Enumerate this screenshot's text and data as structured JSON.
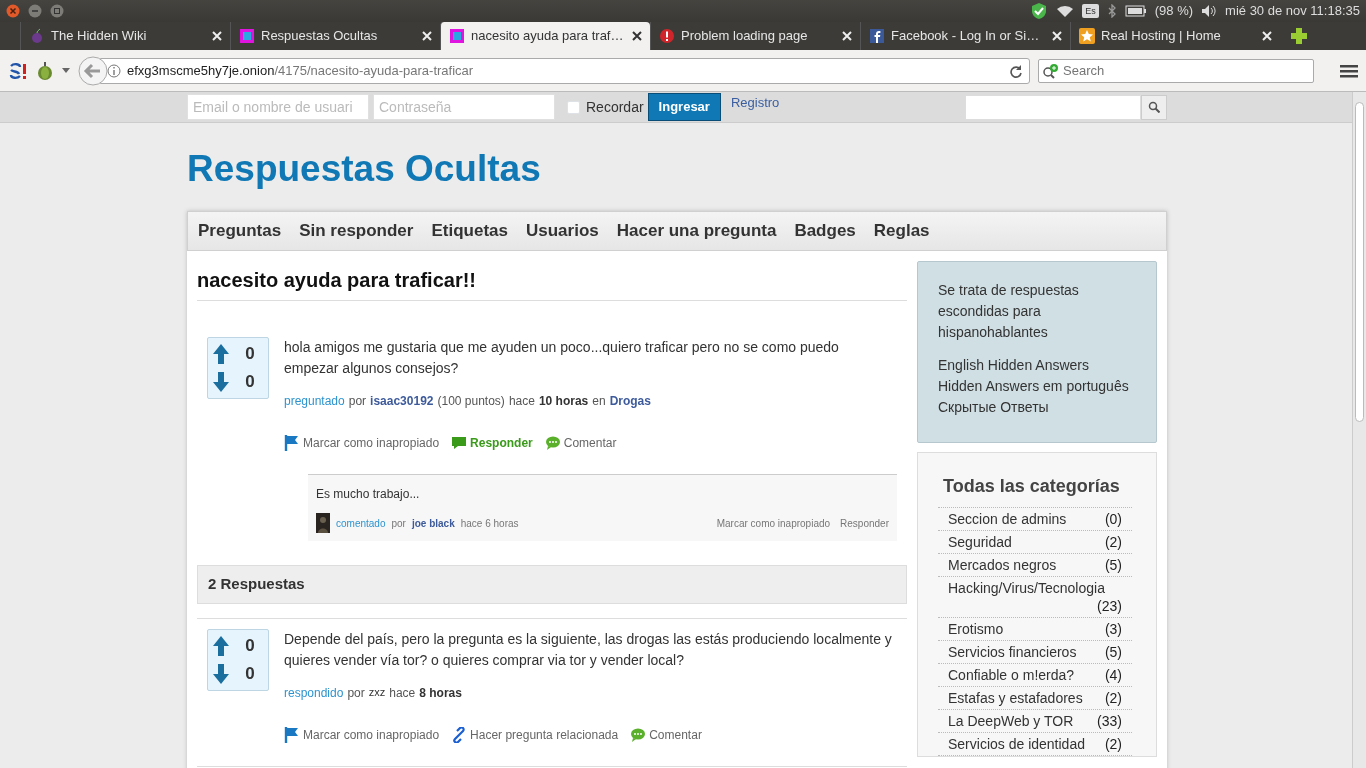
{
  "system_bar": {
    "keyboard": "Es",
    "battery": "(98 %)",
    "clock": "mié 30 de nov 11:18:35"
  },
  "tabs": [
    {
      "title": "The Hidden Wiki",
      "kind": "onion",
      "selected": false
    },
    {
      "title": "Respuestas Ocultas",
      "kind": "site",
      "selected": false
    },
    {
      "title": "nacesito ayuda para traf…",
      "kind": "site",
      "selected": true
    },
    {
      "title": "Problem loading page",
      "kind": "error",
      "selected": false
    },
    {
      "title": "Facebook - Log In or Si…",
      "kind": "facebook",
      "selected": false
    },
    {
      "title": "Real Hosting | Home",
      "kind": "star",
      "selected": false
    }
  ],
  "toolbar": {
    "url_host": "efxg3mscme5hy7je.onion",
    "url_path": "/4175/nacesito-ayuda-para-traficar",
    "search_placeholder": "Search"
  },
  "login": {
    "email_placeholder": "Email o nombre de usuari",
    "password_placeholder": "Contraseña",
    "remember_label": "Recordar",
    "remember_checked": false,
    "login_button": "Ingresar",
    "register_link": "Registro"
  },
  "site_title": "Respuestas Ocultas",
  "nav": [
    "Preguntas",
    "Sin responder",
    "Etiquetas",
    "Usuarios",
    "Hacer una pregunta",
    "Badges",
    "Reglas"
  ],
  "question": {
    "title": "nacesito ayuda para traficar!!",
    "up": "0",
    "down": "0",
    "body": "hola amigos me gustaria que me ayuden un poco...quiero traficar pero no se como puedo empezar algunos consejos?",
    "meta": [
      {
        "kind": "link",
        "text": "preguntado"
      },
      {
        "kind": "text",
        "text": "por"
      },
      {
        "kind": "user",
        "text": "isaac30192"
      },
      {
        "kind": "text",
        "text": "(100 puntos)"
      },
      {
        "kind": "text",
        "text": "hace"
      },
      {
        "kind": "strong",
        "text": "10 horas"
      },
      {
        "kind": "text",
        "text": "en"
      },
      {
        "kind": "user",
        "text": "Drogas"
      }
    ],
    "actions": [
      {
        "kind": "flag",
        "label": "Marcar como inapropiado"
      },
      {
        "kind": "reply",
        "label": "Responder"
      },
      {
        "kind": "comment",
        "label": "Comentar"
      }
    ],
    "comments": [
      {
        "text": "Es mucho trabajo...",
        "meta": [
          {
            "kind": "link",
            "text": "comentado"
          },
          {
            "kind": "text",
            "text": "por"
          },
          {
            "kind": "user",
            "text": "joe black"
          },
          {
            "kind": "text",
            "text": "hace 6 horas"
          }
        ],
        "actions": [
          "Marcar como inapropiado",
          "Responder"
        ]
      }
    ]
  },
  "answers_header": "2 Respuestas",
  "answers": [
    {
      "up": "0",
      "down": "0",
      "body": "Depende del país, pero la pregunta es la siguiente, las drogas las estás produciendo localmente y quieres vender vía tor? o quieres comprar via tor y vender local?",
      "meta": [
        {
          "kind": "link",
          "text": "respondido"
        },
        {
          "kind": "text",
          "text": "por"
        },
        {
          "kind": "plainuser",
          "text": "zxz"
        },
        {
          "kind": "text",
          "text": "hace"
        },
        {
          "kind": "strong",
          "text": "8 horas"
        }
      ],
      "actions": [
        {
          "kind": "flag",
          "label": "Marcar como inapropiado"
        },
        {
          "kind": "related",
          "label": "Hacer pregunta relacionada"
        },
        {
          "kind": "comment",
          "label": "Comentar"
        }
      ]
    }
  ],
  "sidebar": {
    "about": "Se trata de respuestas escondidas para hispanohablantes",
    "links": [
      "English Hidden Answers",
      "Hidden Answers em português",
      "Скрытые Ответы"
    ],
    "categories_title": "Todas las categorías",
    "categories": [
      {
        "name": "Seccion de admins",
        "count": "(0)"
      },
      {
        "name": "Seguridad",
        "count": "(2)"
      },
      {
        "name": "Mercados negros",
        "count": "(5)"
      },
      {
        "name": "Hacking/Virus/Tecnologia",
        "count": "(23)"
      },
      {
        "name": "Erotismo",
        "count": "(3)"
      },
      {
        "name": "Servicios financieros",
        "count": "(5)"
      },
      {
        "name": "Confiable o m!erda?",
        "count": "(4)"
      },
      {
        "name": "Estafas y estafadores",
        "count": "(2)"
      },
      {
        "name": "La DeepWeb y TOR",
        "count": "(33)"
      },
      {
        "name": "Servicios de identidad",
        "count": "(2)"
      }
    ]
  }
}
